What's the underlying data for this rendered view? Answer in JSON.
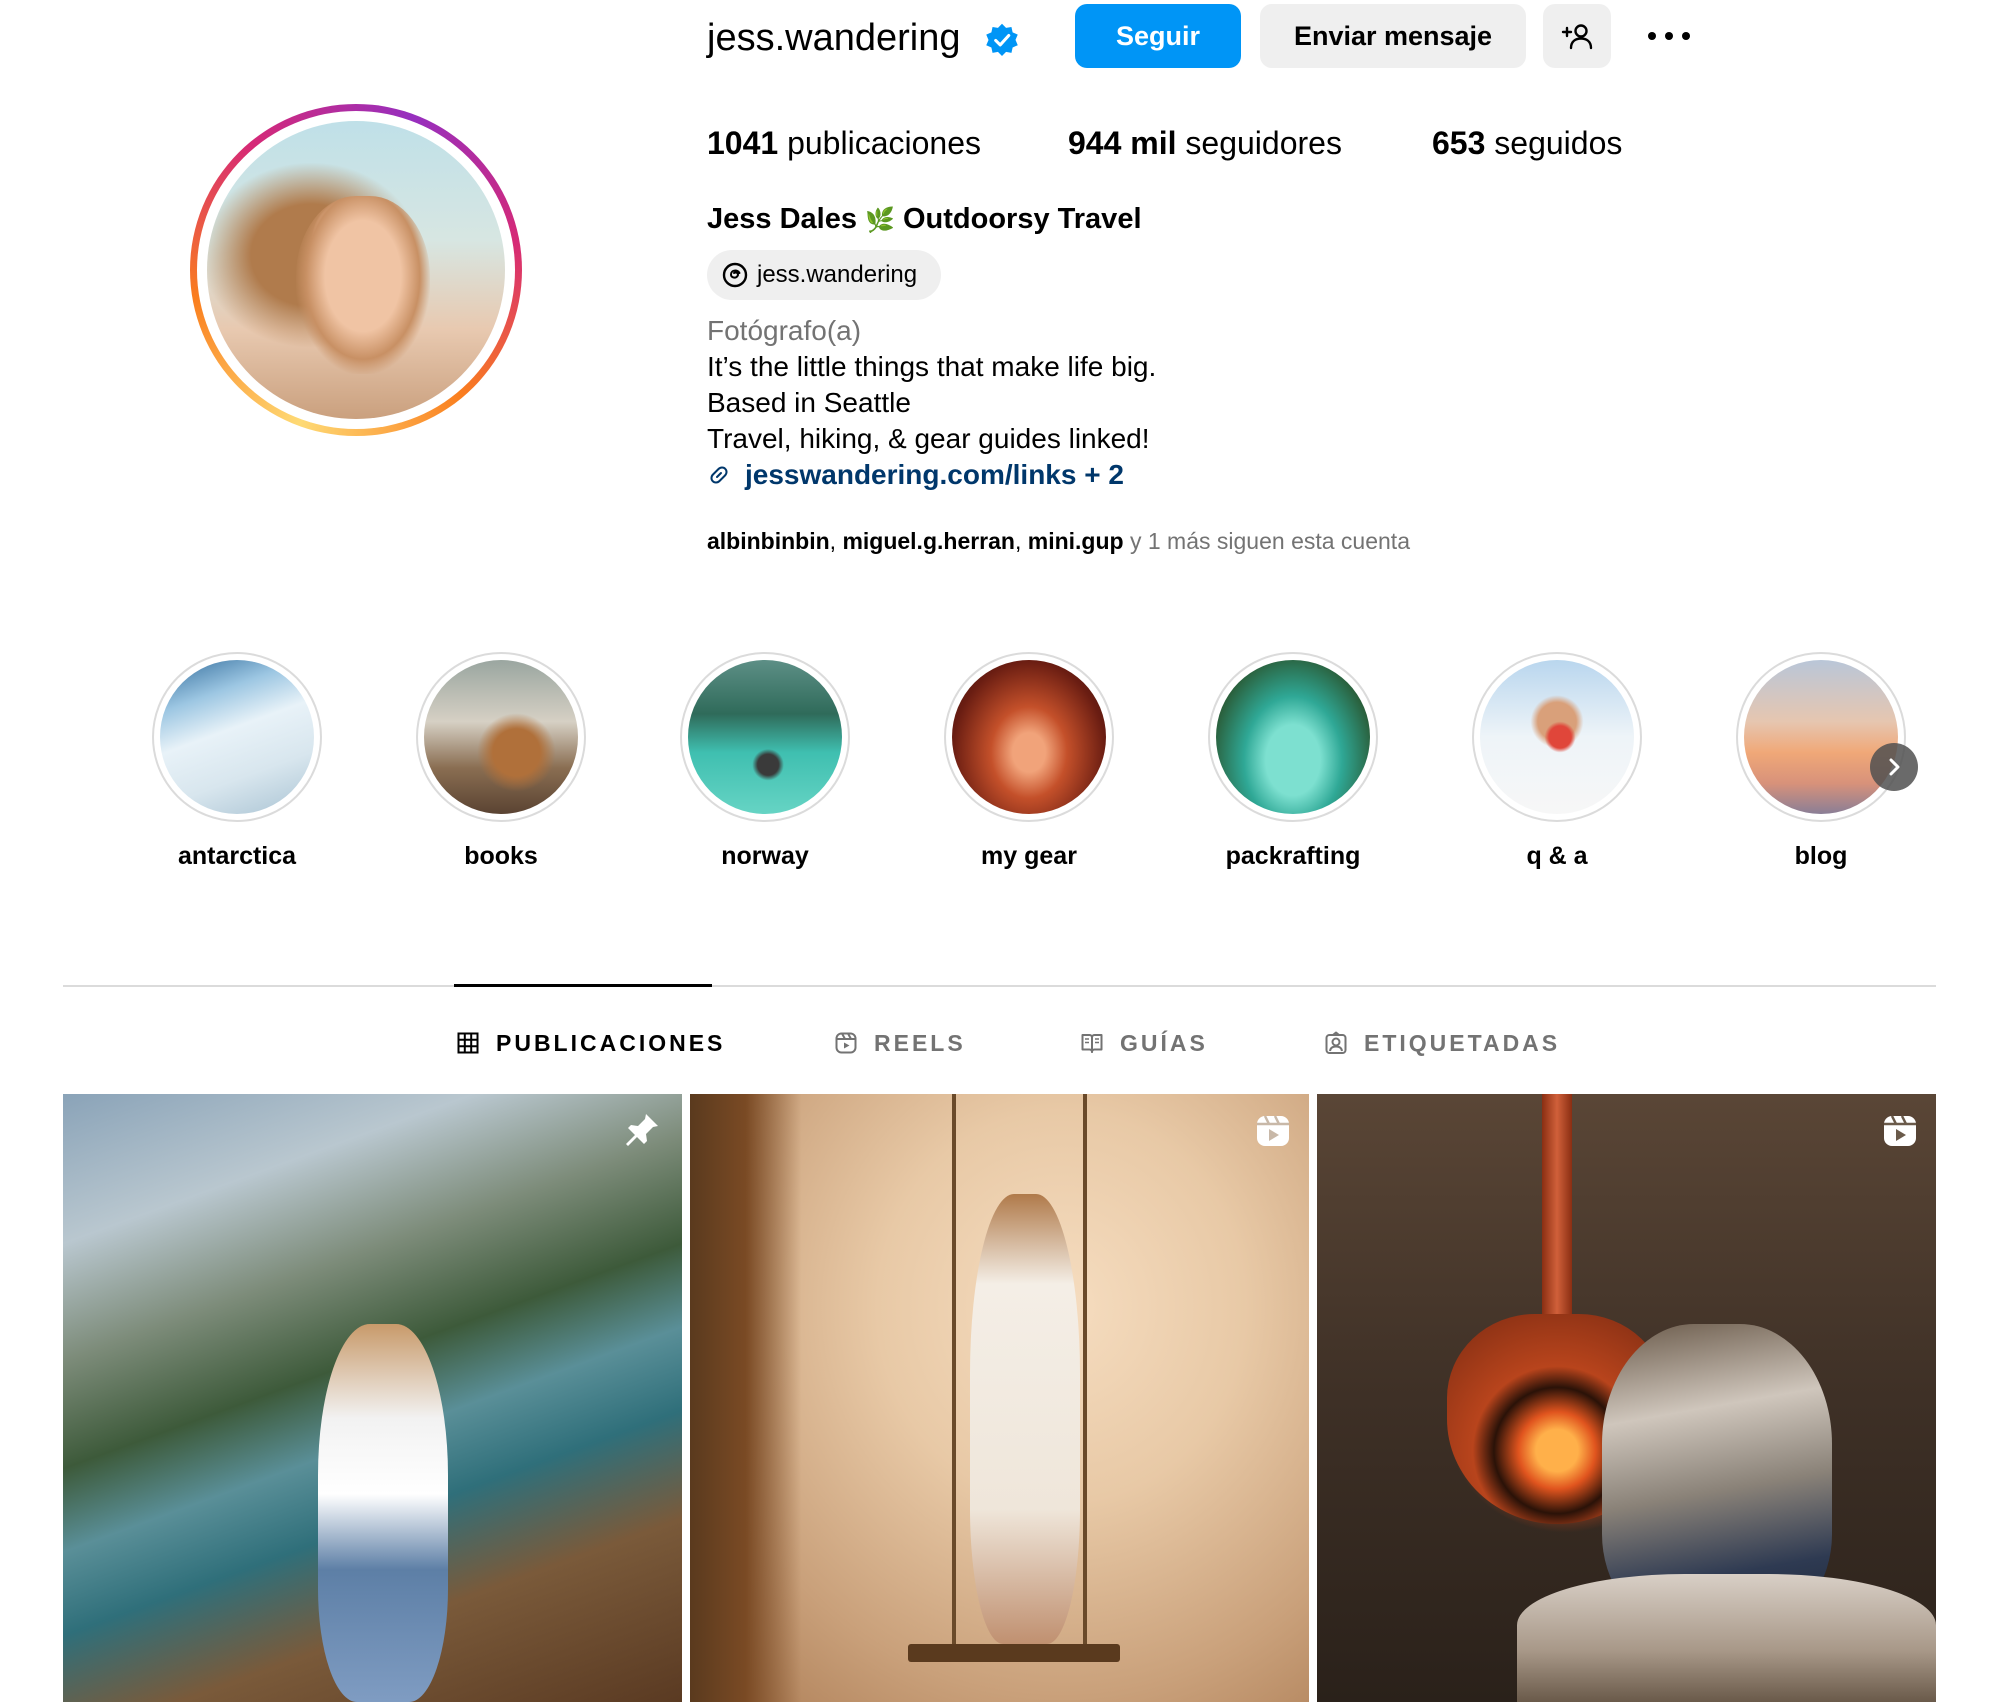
{
  "profile": {
    "username": "jess.wandering",
    "verified_icon": "verified-badge-icon",
    "follow_label": "Seguir",
    "message_label": "Enviar mensaje",
    "suggest_icon": "add-person-icon",
    "more_icon": "more-options-icon",
    "stats": {
      "posts_count": "1041",
      "posts_label": "publicaciones",
      "followers_count": "944 mil",
      "followers_label": "seguidores",
      "following_count": "653",
      "following_label": "seguidos"
    },
    "full_name": "Jess Dales",
    "name_emoji": "🌿",
    "name_suffix": "Outdoorsy Travel",
    "threads_handle": "jess.wandering",
    "category": "Fotógrafo(a)",
    "bio": [
      "It’s the little things that make life big.",
      "Based in Seattle",
      "Travel, hiking, & gear guides linked!"
    ],
    "link": "jesswandering.com/links + 2",
    "followed_by": {
      "names": [
        "albinbinbin",
        "miguel.g.herran",
        "mini.gup"
      ],
      "suffix": "y 1 más siguen esta cuenta"
    }
  },
  "highlights": [
    {
      "label": "antarctica"
    },
    {
      "label": "books"
    },
    {
      "label": "norway"
    },
    {
      "label": "my gear"
    },
    {
      "label": "packrafting"
    },
    {
      "label": "q & a"
    },
    {
      "label": "blog"
    }
  ],
  "tabs": [
    {
      "label": "PUBLICACIONES",
      "icon": "grid-icon",
      "active": true
    },
    {
      "label": "REELS",
      "icon": "reels-icon",
      "active": false
    },
    {
      "label": "GUÍAS",
      "icon": "guides-icon",
      "active": false
    },
    {
      "label": "ETIQUETADAS",
      "icon": "tagged-icon",
      "active": false
    }
  ],
  "posts": [
    {
      "icon": "pin-icon"
    },
    {
      "icon": "reels-icon"
    },
    {
      "icon": "reels-icon"
    }
  ],
  "colors": {
    "accent": "#0095f6",
    "link": "#00376b",
    "muted": "#737373"
  }
}
